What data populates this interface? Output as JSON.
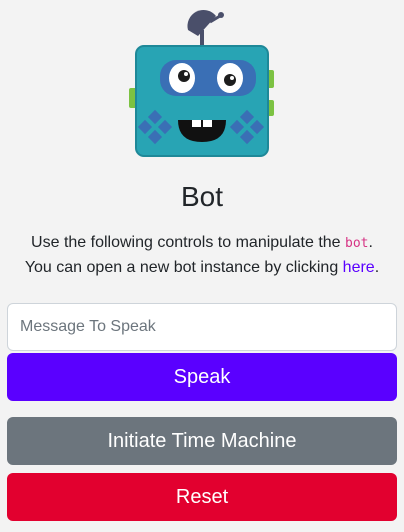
{
  "header": {
    "title": "Bot",
    "logo_icon": "robot-icon"
  },
  "description": {
    "line1_prefix": "Use the following controls to manipulate the ",
    "line1_code": "bot",
    "line1_suffix": ".",
    "line2_prefix": "You can open a new bot instance by clicking ",
    "line2_link": "here",
    "line2_suffix": "."
  },
  "controls": {
    "message_placeholder": "Message To Speak",
    "message_value": "",
    "speak_label": "Speak",
    "time_machine_label": "Initiate Time Machine",
    "reset_label": "Reset"
  },
  "colors": {
    "primary": "#5a00ff",
    "secondary": "#6c757d",
    "danger": "#e2002f",
    "robot_body": "#28a4b4"
  }
}
